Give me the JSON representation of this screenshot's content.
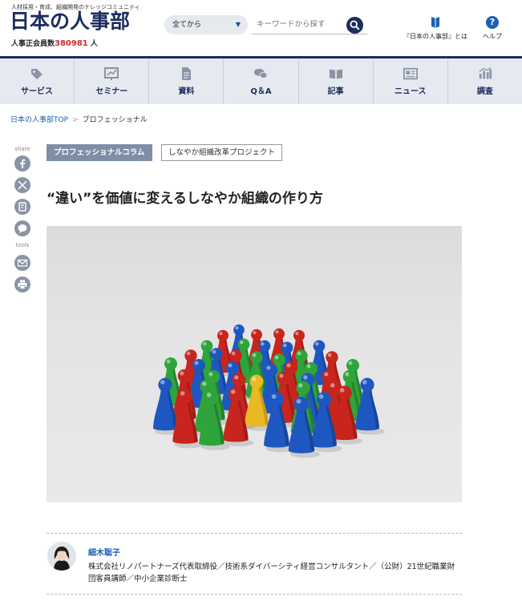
{
  "header": {
    "tagline": "人材採用・育成、組織開発のナレッジコミュニティ",
    "logo": "日本の人事部",
    "members_label": "人事正会員数",
    "members_count": "380981",
    "members_unit": "人",
    "select_value": "全てから",
    "search_placeholder": "キーワードから探す",
    "about_label": "『日本の人事部』とは",
    "help_label": "ヘルプ"
  },
  "nav": {
    "items": [
      {
        "label": "サービス",
        "icon": "tag-icon"
      },
      {
        "label": "セミナー",
        "icon": "chart-board-icon"
      },
      {
        "label": "資料",
        "icon": "document-icon"
      },
      {
        "label": "Q＆A",
        "icon": "chat-bubbles-icon"
      },
      {
        "label": "記事",
        "icon": "open-book-icon"
      },
      {
        "label": "ニュース",
        "icon": "newspaper-icon"
      },
      {
        "label": "調査",
        "icon": "bar-chart-icon"
      }
    ]
  },
  "breadcrumb": {
    "home": "日本の人事部TOP",
    "separator": ">",
    "current": "プロフェッショナル"
  },
  "sidebar": {
    "share_label": "share",
    "tools_label": "tools",
    "share_icons": [
      "facebook-icon",
      "x-icon",
      "hatena-icon",
      "line-icon"
    ],
    "tool_icons": [
      "mail-icon",
      "print-icon"
    ]
  },
  "article": {
    "tag_primary": "プロフェッショナルコラム",
    "tag_secondary": "しなやか組織改革プロジェクト",
    "title": "“違い”を価値に変えるしなやか組織の作り方"
  },
  "author": {
    "name": "細木聡子",
    "bio": "株式会社リノパートナーズ代表取締役／技術系ダイバーシティ経営コンサルタント／（公財）21世紀職業財団客員講師／中小企業診断士"
  },
  "colors": {
    "brand_navy": "#1c2d5e",
    "link_blue": "#1c5fb5",
    "accent_red": "#d42a2a",
    "nav_bg": "#e6e9ef",
    "tag_bg": "#7d8ea6"
  }
}
